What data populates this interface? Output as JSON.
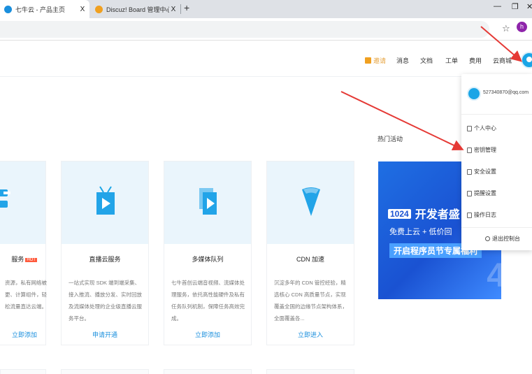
{
  "browser": {
    "tabs": [
      {
        "title": "七牛云 - 产品主页",
        "active": true,
        "favicon_color": "#1a8fdd"
      },
      {
        "title": "Discuz! Board 管理中心 - 应用",
        "active": false,
        "favicon_color": "#f0a020"
      }
    ],
    "new_tab": "+",
    "close_glyph": "X",
    "window_controls": {
      "minimize": "—",
      "restore": "❐",
      "close": "✕"
    },
    "bookmark_icon": "star-icon",
    "profile_initial": "h"
  },
  "header": {
    "nav": [
      "邀请",
      "消息",
      "文档",
      "工单",
      "费用",
      "云商城"
    ],
    "invite_color": "#e6a23c"
  },
  "cards": [
    {
      "name": "服务",
      "badge": "HOT",
      "desc": "资源，私有网络被更、计算组件，轻松流量直达云端。",
      "action": "立即添加",
      "icon": "server-icon"
    },
    {
      "name": "直播云服务",
      "desc": "一站式实现 SDK 端到端采集、接入推流、播放分发、实时回放及流媒体处理的企业级直播云服务平台。",
      "action": "申请开通",
      "icon": "tv-icon"
    },
    {
      "name": "多媒体队列",
      "desc": "七牛首创云端音视频、流媒体处理服务，依托高性能硬件及私有任务队列机制，保障任务高效完成。",
      "action": "立即添加",
      "icon": "play-file-icon"
    },
    {
      "name": "CDN 加速",
      "desc": "沉淀多年的 CDN 管控经验，精选核心 CDN 高质量节点，实现覆盖全国的边缘节点架构体系，全面覆盖各...",
      "action": "立即进入",
      "icon": "cone-icon"
    }
  ],
  "hot_events": {
    "title": "热门活动",
    "banner": {
      "badge": "1024",
      "line1": "开发者盛",
      "line2": "免费上云 + 低价回",
      "line3": "开启程序员节专属福利",
      "deco": "4"
    }
  },
  "dropdown": {
    "email": "527340870@qq.com",
    "items": [
      {
        "label": "个人中心",
        "icon": "user-icon"
      },
      {
        "label": "密钥管理",
        "icon": "key-icon"
      },
      {
        "label": "安全设置",
        "icon": "lock-icon"
      },
      {
        "label": "提醒设置",
        "icon": "bell-icon"
      },
      {
        "label": "操作日志",
        "icon": "log-icon"
      }
    ],
    "logout": "退出控制台"
  },
  "colors": {
    "accent": "#1a8fdd",
    "arrow": "#e53935",
    "hot": "#ff5a3c"
  }
}
